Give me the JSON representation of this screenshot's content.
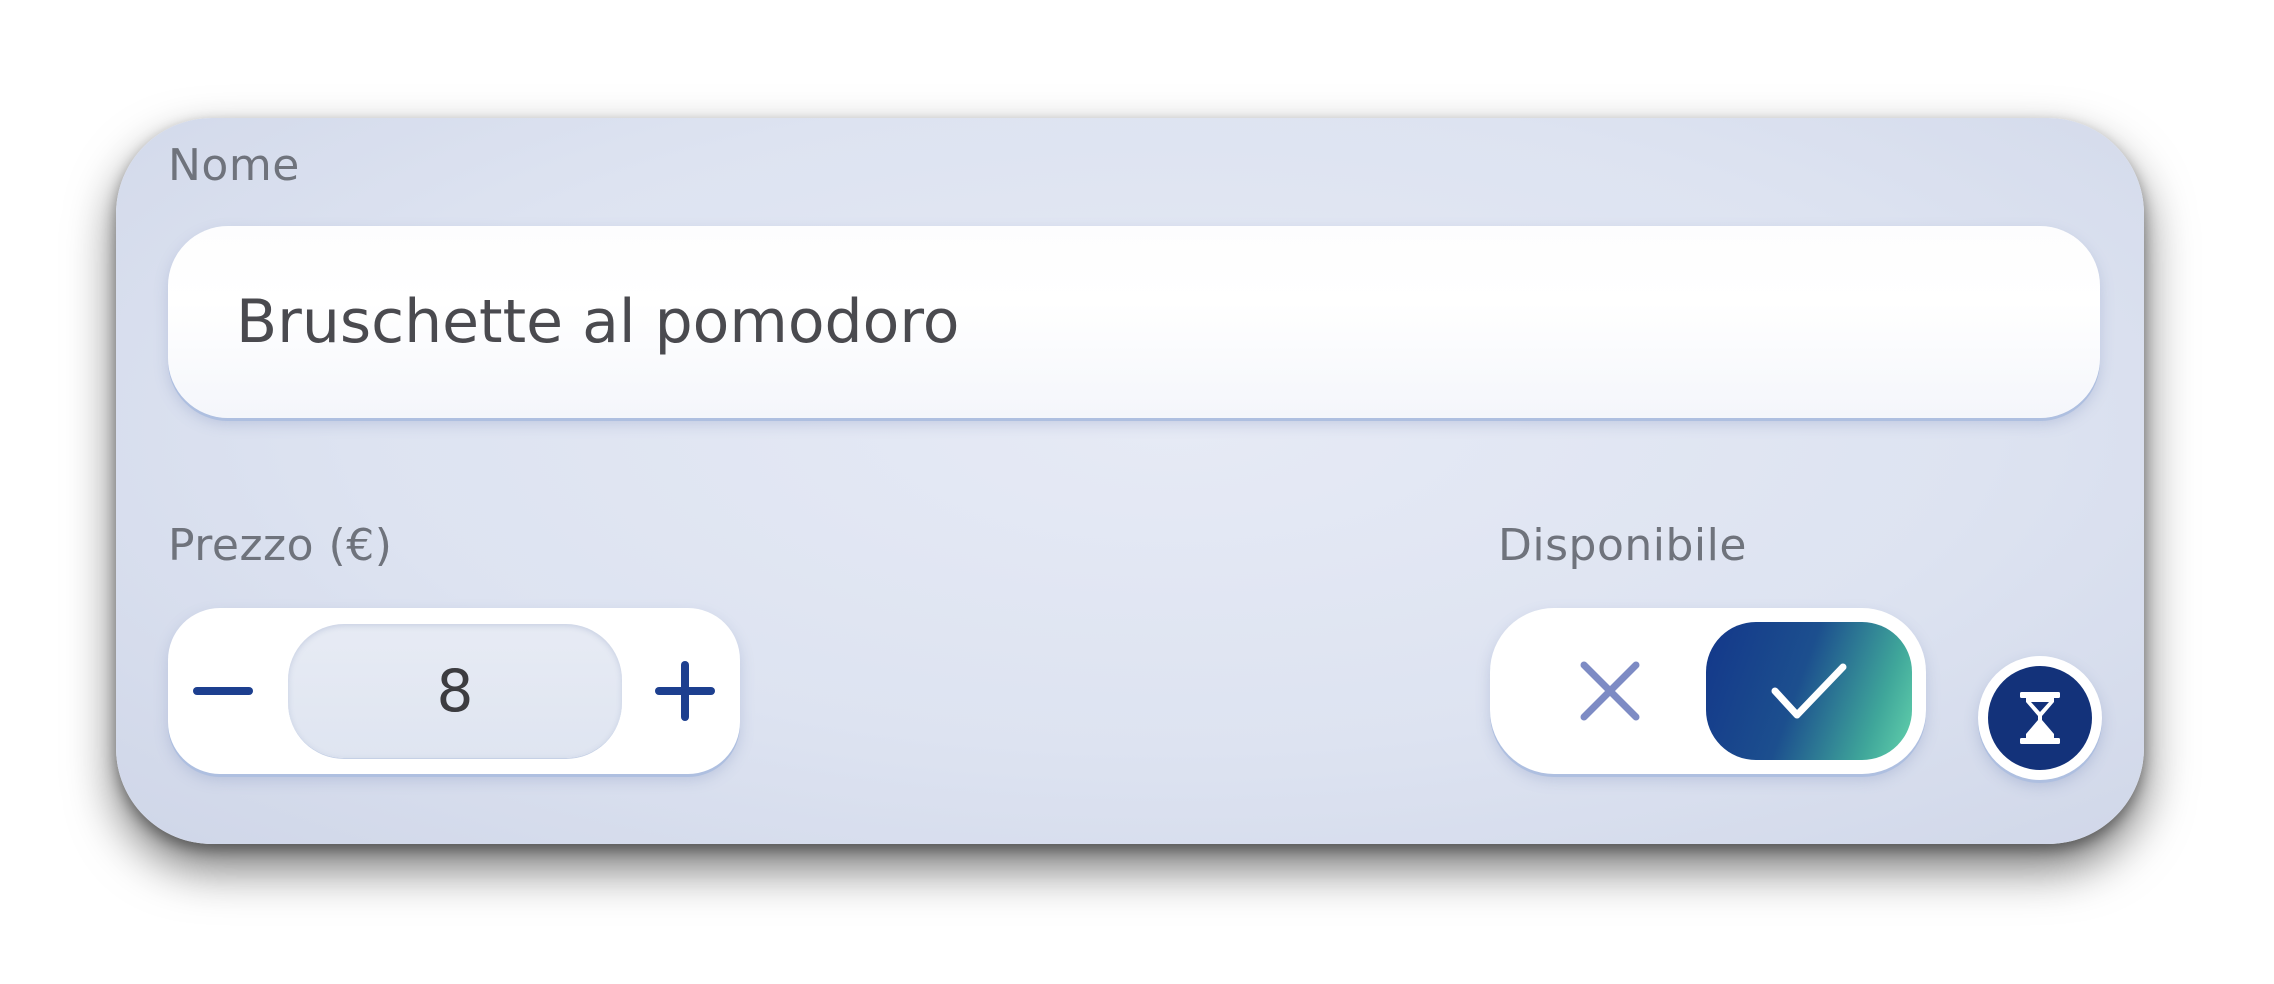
{
  "form": {
    "name_label": "Nome",
    "name_value": "Bruschette al pomodoro",
    "price_label": "Prezzo (€)",
    "price_value": "8",
    "available_label": "Disponibile",
    "available": true
  },
  "icons": {
    "decrement": "minus-icon",
    "increment": "plus-icon",
    "unavailable": "close-icon",
    "available": "check-icon",
    "timer": "hourglass-icon"
  },
  "colors": {
    "accent_dark": "#13378a",
    "accent_light": "#64d3ad",
    "stepper_icon": "#1d3f8f",
    "x_icon": "#7d8bc4",
    "text": "#4a4a4f",
    "label": "#6f737c"
  }
}
